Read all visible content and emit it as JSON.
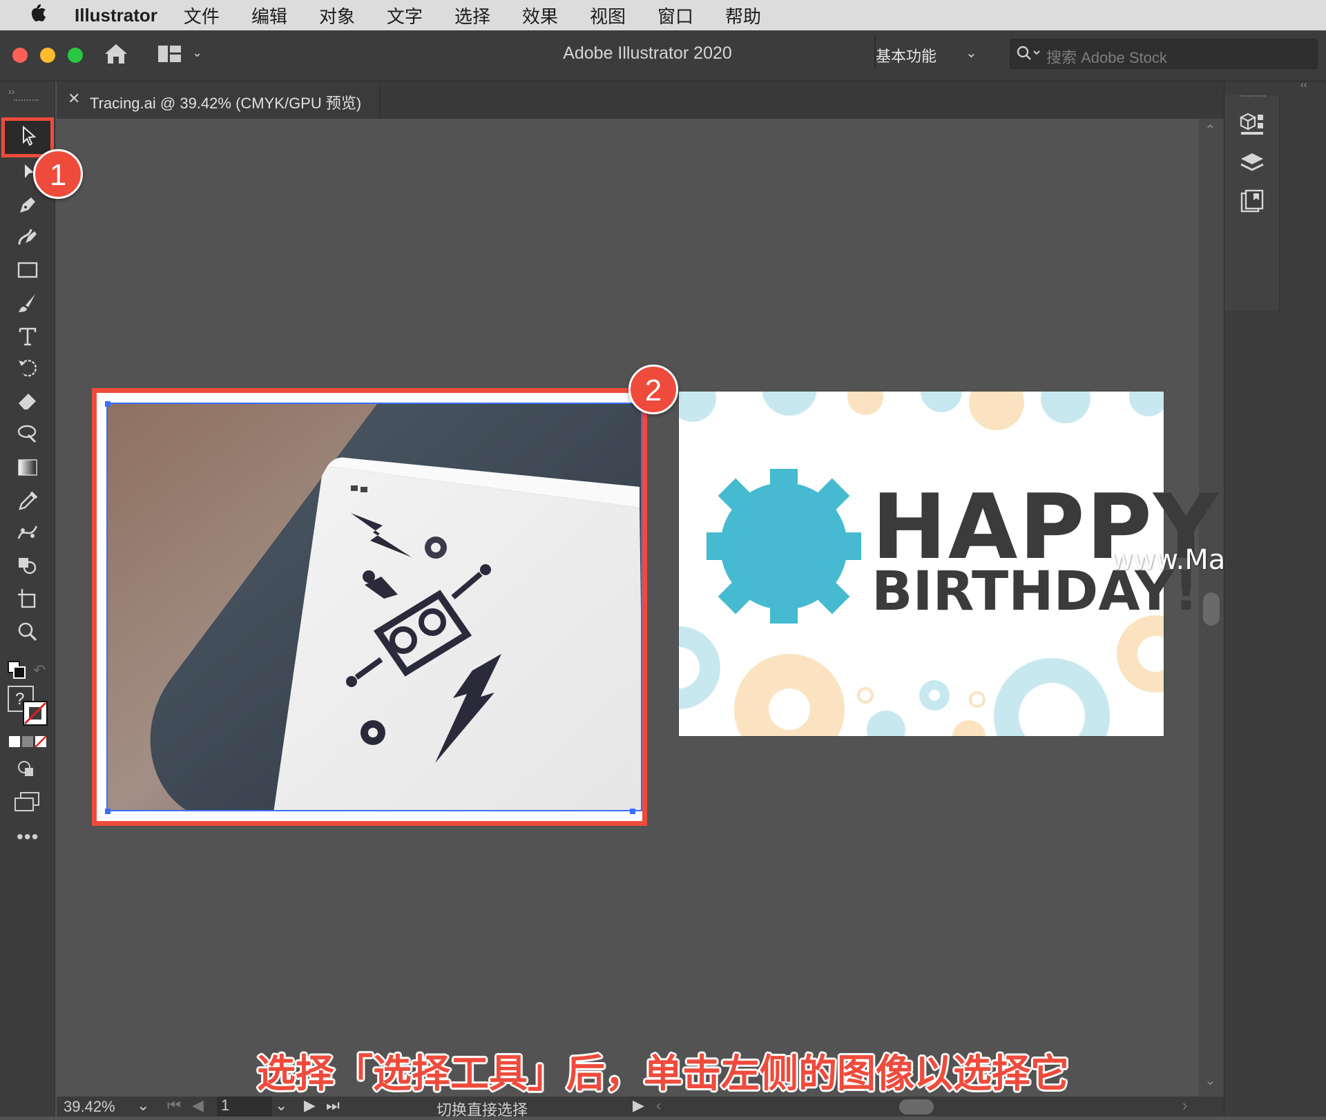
{
  "menubar": {
    "app_name": "Illustrator",
    "items": [
      "文件",
      "编辑",
      "对象",
      "文字",
      "选择",
      "效果",
      "视图",
      "窗口",
      "帮助"
    ]
  },
  "window": {
    "title": "Adobe Illustrator 2020",
    "workspace": "基本功能",
    "search_placeholder": "搜索 Adobe Stock"
  },
  "document": {
    "tab_label": "Tracing.ai @ 39.42% (CMYK/GPU 预览)"
  },
  "artboard_card": {
    "line1": "HAPPY",
    "line2": "BIRTHDAY!"
  },
  "status": {
    "zoom": "39.42%",
    "page": "1",
    "tool_hint": "切换直接选择"
  },
  "annotations": {
    "badge1": "1",
    "badge2": "2",
    "caption": "选择「选择工具」后，单击左侧的图像以选择它"
  },
  "watermark": "www.MacZ.com",
  "colors": {
    "highlight": "#ee4b3c",
    "gear_teal": "#45bad0",
    "gear_light_blue": "#c8e8f0",
    "gear_peach": "#fbe3c1"
  }
}
